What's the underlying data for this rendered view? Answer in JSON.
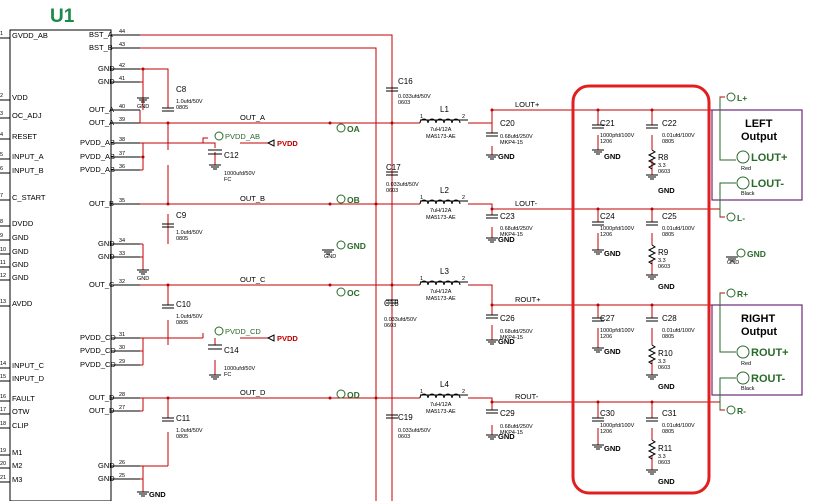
{
  "chip": {
    "ref": "U1"
  },
  "left_pins": [
    "GVDD_AB",
    "VDD",
    "OC_ADJ",
    "RESET",
    "INPUT_A",
    "INPUT_B",
    "C_START",
    "DVDD",
    "GND",
    "GND",
    "GND",
    "GND",
    "AVDD",
    "INPUT_C",
    "INPUT_D",
    "FAULT",
    "OTW",
    "CLIP",
    "M1",
    "M2",
    "M3"
  ],
  "left_pin_nums": [
    "1",
    "2",
    "3",
    "4",
    "5",
    "6",
    "7",
    "8",
    "9",
    "10",
    "11",
    "12",
    "13",
    "14",
    "15",
    "16",
    "17",
    "18",
    "19",
    "20",
    "21"
  ],
  "right_pins": [
    {
      "name": "BST_A",
      "num": "44"
    },
    {
      "name": "BST_B",
      "num": "43"
    },
    {
      "name": "GND",
      "num": "42"
    },
    {
      "name": "GND",
      "num": "41"
    },
    {
      "name": "OUT_A",
      "num": "40"
    },
    {
      "name": "OUT_A",
      "num": "39"
    },
    {
      "name": "PVDD_AB",
      "num": "38"
    },
    {
      "name": "PVDD_AB",
      "num": "37"
    },
    {
      "name": "PVDD_AB",
      "num": "36"
    },
    {
      "name": "OUT_B",
      "num": "35"
    },
    {
      "name": "GND",
      "num": "34"
    },
    {
      "name": "GND",
      "num": "33"
    },
    {
      "name": "OUT_C",
      "num": "32"
    },
    {
      "name": "PVDD_CD",
      "num": "31"
    },
    {
      "name": "PVDD_CD",
      "num": "30"
    },
    {
      "name": "PVDD_CD",
      "num": "29"
    },
    {
      "name": "OUT_D",
      "num": "28"
    },
    {
      "name": "OUT_D",
      "num": "27"
    },
    {
      "name": "GND",
      "num": "26"
    },
    {
      "name": "GND",
      "num": "25"
    }
  ],
  "nets": {
    "out_a": "OUT_A",
    "out_b": "OUT_B",
    "out_c": "OUT_C",
    "out_d": "OUT_D",
    "lout_p": "LOUT+",
    "lout_m": "LOUT-",
    "rout_p": "ROUT+",
    "rout_m": "ROUT-"
  },
  "testpoints": {
    "oa": "OA",
    "ob": "OB",
    "oc": "OC",
    "od": "OD",
    "gnd": "GND",
    "pvdd_ab": "PVDD_AB",
    "pvdd_cd": "PVDD_CD",
    "pvdd": "PVDD"
  },
  "gnd_label": "GND",
  "gnd_small": "GND",
  "caps": {
    "C8": {
      "ref": "C8",
      "v1": "1.0ufd/50V",
      "v2": "0805"
    },
    "C9": {
      "ref": "C9",
      "v1": "1.0ufd/50V",
      "v2": "0805"
    },
    "C10": {
      "ref": "C10",
      "v1": "1.0ufd/50V",
      "v2": "0805"
    },
    "C11": {
      "ref": "C11",
      "v1": "1.0ufd/50V",
      "v2": "0805"
    },
    "C12": {
      "ref": "C12",
      "v1": "1000ufd/50V",
      "v2": "FC"
    },
    "C14": {
      "ref": "C14",
      "v1": "1000ufd/50V",
      "v2": "FC"
    },
    "C16": {
      "ref": "C16",
      "v1": "0.033ufd/50V",
      "v2": "0603"
    },
    "C17": {
      "ref": "C17",
      "v1": "0.033ufd/50V",
      "v2": "0603"
    },
    "C18": {
      "ref": "C18",
      "v1": "0.033ufd/50V",
      "v2": "0603"
    },
    "C19": {
      "ref": "C19",
      "v1": "0.033ufd/50V",
      "v2": "0603"
    },
    "C20": {
      "ref": "C20",
      "v1": "0.68ufd/250V",
      "v2": "MKP4-15"
    },
    "C23": {
      "ref": "C23",
      "v1": "0.68ufd/250V",
      "v2": "MKP4-15"
    },
    "C26": {
      "ref": "C26",
      "v1": "0.68ufd/250V",
      "v2": "MKP4-15"
    },
    "C29": {
      "ref": "C29",
      "v1": "0.68ufd/250V",
      "v2": "MKP4-15"
    },
    "C21": {
      "ref": "C21",
      "v1": "1000pfd/100V",
      "v2": "1206"
    },
    "C24": {
      "ref": "C24",
      "v1": "1000pfd/100V",
      "v2": "1206"
    },
    "C27": {
      "ref": "C27",
      "v1": "1000pfd/100V",
      "v2": "1206"
    },
    "C30": {
      "ref": "C30",
      "v1": "1000pfd/100V",
      "v2": "1206"
    },
    "C22": {
      "ref": "C22",
      "v1": "0.01ufd/100V",
      "v2": "0805"
    },
    "C25": {
      "ref": "C25",
      "v1": "0.01ufd/100V",
      "v2": "0805"
    },
    "C28": {
      "ref": "C28",
      "v1": "0.01ufd/100V",
      "v2": "0805"
    },
    "C31": {
      "ref": "C31",
      "v1": "0.01ufd/100V",
      "v2": "0805"
    }
  },
  "inductors": {
    "L1": {
      "ref": "L1",
      "v1": "7uH/12A",
      "v2": "MA5173-AE",
      "p1": "1",
      "p2": "2"
    },
    "L2": {
      "ref": "L2",
      "v1": "7uH/12A",
      "v2": "MA5173-AE",
      "p1": "1",
      "p2": "2"
    },
    "L3": {
      "ref": "L3",
      "v1": "7uH/12A",
      "v2": "MA5173-AE",
      "p1": "1",
      "p2": "2"
    },
    "L4": {
      "ref": "L4",
      "v1": "7uH/12A",
      "v2": "MA5173-AE",
      "p1": "1",
      "p2": "2"
    }
  },
  "resistors": {
    "R8": {
      "ref": "R8",
      "v1": "3.3",
      "v2": "0603"
    },
    "R9": {
      "ref": "R9",
      "v1": "3.3",
      "v2": "0603"
    },
    "R10": {
      "ref": "R10",
      "v1": "3.3",
      "v2": "0603"
    },
    "R11": {
      "ref": "R11",
      "v1": "3.3",
      "v2": "0603"
    }
  },
  "outputs": {
    "left_title_1": "LEFT",
    "left_title_2": "Output",
    "right_title_1": "RIGHT",
    "right_title_2": "Output",
    "lplus": "L+",
    "lminus": "L-",
    "rplus": "R+",
    "rminus": "R-",
    "red": "Red",
    "black": "Black",
    "gnd": "GND"
  },
  "colors": {
    "wire": "#c00000",
    "highlight": "#e02020",
    "label_green": "#2a6a2a",
    "box_purple": "#6a2a7a",
    "title_green": "#1a8a4a"
  }
}
